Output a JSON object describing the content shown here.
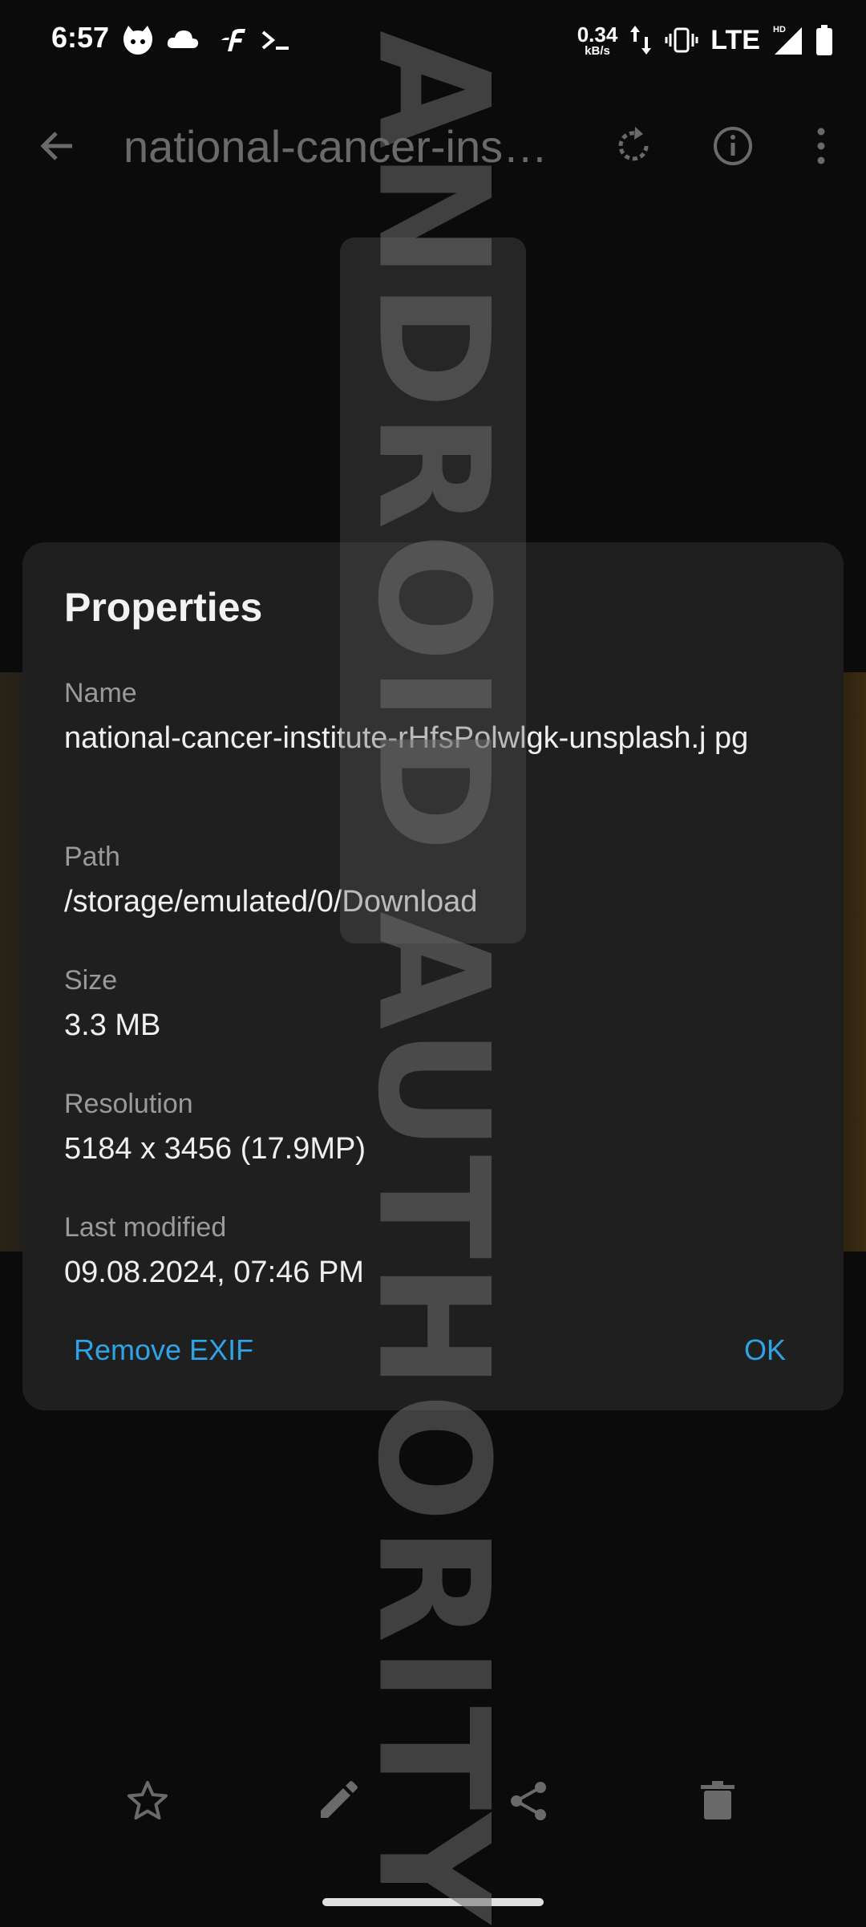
{
  "status_bar": {
    "time": "6:57",
    "icons": [
      "cat-app-icon",
      "cloud-icon",
      "f-app-icon",
      "terminal-icon"
    ],
    "net_speed_value": "0.34",
    "net_speed_unit": "kB/s",
    "network_type": "LTE",
    "right_icons": [
      "data-arrows-icon",
      "vibrate-icon",
      "hd-signal-icon",
      "battery-icon"
    ]
  },
  "app_bar": {
    "title": "national-cancer-ins…",
    "icons": [
      "back-arrow-icon",
      "rotate-icon",
      "info-icon",
      "more-vert-icon"
    ]
  },
  "dialog": {
    "title": "Properties",
    "name_label": "Name",
    "name_value": "national-cancer-institute-rHfsPolwlgk-unsplash.j pg",
    "path_label": "Path",
    "path_value": "/storage/emulated/0/Download",
    "size_label": "Size",
    "size_value": "3.3 MB",
    "resolution_label": "Resolution",
    "resolution_value": "5184 x 3456 (17.9MP)",
    "modified_label": "Last modified",
    "modified_value": "09.08.2024, 07:46 PM",
    "remove_exif_label": "Remove EXIF",
    "ok_label": "OK"
  },
  "watermark": "ANDROID AUTHORITY",
  "bottom_bar": {
    "icons": [
      "star-icon",
      "edit-icon",
      "share-icon",
      "delete-icon"
    ]
  },
  "colors": {
    "accent": "#2ea3e6",
    "dialog_bg": "#1f1f1f",
    "background": "#0b0b0b"
  }
}
